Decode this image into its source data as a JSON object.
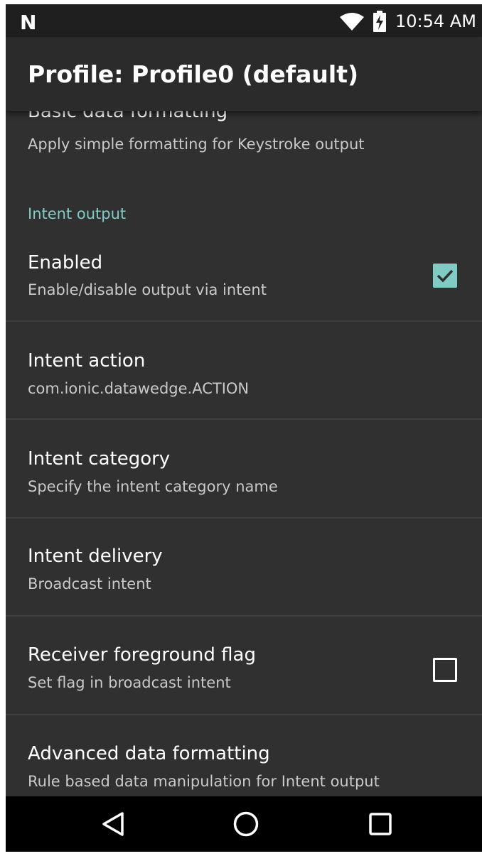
{
  "status_bar": {
    "notification_icon": "n-logo-icon",
    "wifi_icon": "wifi-icon",
    "battery_icon": "battery-charging-icon",
    "time": "10:54 AM"
  },
  "app_bar": {
    "title": "Profile: Profile0 (default)"
  },
  "preferences": {
    "basic_formatting": {
      "title": "Basic data formatting",
      "summary": "Apply simple formatting for Keystroke output"
    },
    "intent_category_header": "Intent output",
    "enabled": {
      "title": "Enabled",
      "summary": "Enable/disable output via intent",
      "checked": true
    },
    "intent_action": {
      "title": "Intent action",
      "summary": "com.ionic.datawedge.ACTION"
    },
    "intent_category": {
      "title": "Intent category",
      "summary": "Specify the intent category name"
    },
    "intent_delivery": {
      "title": "Intent delivery",
      "summary": "Broadcast intent"
    },
    "receiver_foreground_flag": {
      "title": "Receiver foreground flag",
      "summary": "Set flag in broadcast intent",
      "checked": false
    },
    "advanced_formatting": {
      "title": "Advanced data formatting",
      "summary": "Rule based data manipulation for Intent output"
    }
  },
  "nav_bar": {
    "back_icon": "back-icon",
    "home_icon": "home-icon",
    "recents_icon": "recents-icon"
  },
  "colors": {
    "background": "#303030",
    "accent": "#80cbc4",
    "app_bar": "#2b2b2b",
    "nav_bar": "#000000"
  }
}
